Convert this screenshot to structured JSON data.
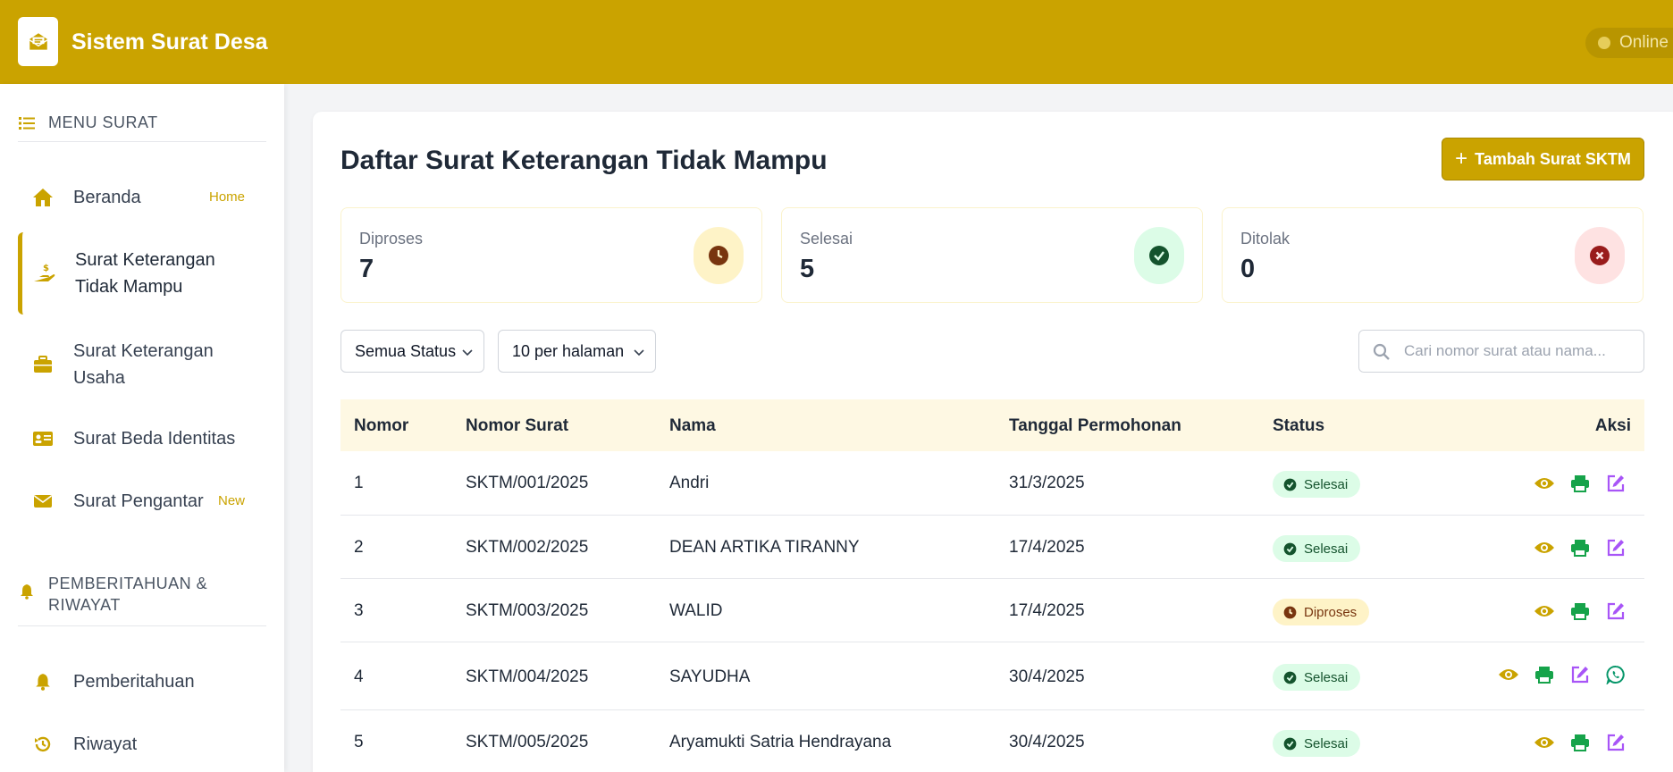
{
  "header": {
    "app_title": "Sistem Surat Desa",
    "status_label": "Online",
    "brand_color": "#caa300"
  },
  "sidebar": {
    "menu_heading": "MENU SURAT",
    "items": [
      {
        "label": "Beranda",
        "badge": "Home",
        "icon": "home-icon"
      },
      {
        "label_line1": "Surat Keterangan",
        "label_line2": "Tidak Mampu",
        "icon": "hand-money-icon",
        "active": true
      },
      {
        "label_line1": "Surat Keterangan",
        "label_line2": "Usaha",
        "icon": "briefcase-icon"
      },
      {
        "label": "Surat Beda Identitas",
        "icon": "id-card-icon"
      },
      {
        "label": "Surat Pengantar",
        "badge": "New",
        "icon": "envelope-icon"
      }
    ],
    "notif_heading_line1": "PEMBERITAHUAN &",
    "notif_heading_line2": "RIWAYAT",
    "notif_items": [
      {
        "label": "Pemberitahuan",
        "icon": "bell-icon"
      },
      {
        "label": "Riwayat",
        "icon": "history-icon"
      }
    ]
  },
  "main": {
    "title": "Daftar Surat Keterangan Tidak Mampu",
    "add_button": "Tambah Surat SKTM",
    "stats": [
      {
        "label": "Diproses",
        "value": "7",
        "icon": "clock-icon",
        "bg": "#fef3c7",
        "color": "#78350f"
      },
      {
        "label": "Selesai",
        "value": "5",
        "icon": "check-circle-icon",
        "bg": "#dcfce7",
        "color": "#14532d"
      },
      {
        "label": "Ditolak",
        "value": "0",
        "icon": "x-circle-icon",
        "bg": "#fee2e2",
        "color": "#991b1b"
      }
    ],
    "filters": {
      "status_selected": "Semua Status",
      "per_page_selected": "10 per halaman"
    },
    "search": {
      "placeholder": "Cari nomor surat atau nama..."
    },
    "table": {
      "columns": [
        "Nomor",
        "Nomor Surat",
        "Nama",
        "Tanggal Permohonan",
        "Status",
        "Aksi"
      ],
      "rows": [
        {
          "no": "1",
          "nomor_surat": "SKTM/001/2025",
          "nama": "Andri",
          "tanggal": "31/3/2025",
          "status": "Selesai"
        },
        {
          "no": "2",
          "nomor_surat": "SKTM/002/2025",
          "nama": "DEAN ARTIKA TIRANNY",
          "tanggal": "17/4/2025",
          "status": "Selesai"
        },
        {
          "no": "3",
          "nomor_surat": "SKTM/003/2025",
          "nama": "WALID",
          "tanggal": "17/4/2025",
          "status": "Diproses"
        },
        {
          "no": "4",
          "nomor_surat": "SKTM/004/2025",
          "nama": "SAYUDHA",
          "tanggal": "30/4/2025",
          "status": "Selesai"
        },
        {
          "no": "5",
          "nomor_surat": "SKTM/005/2025",
          "nama": "Aryamukti Satria Hendrayana",
          "tanggal": "30/4/2025",
          "status": "Selesai"
        }
      ]
    }
  }
}
